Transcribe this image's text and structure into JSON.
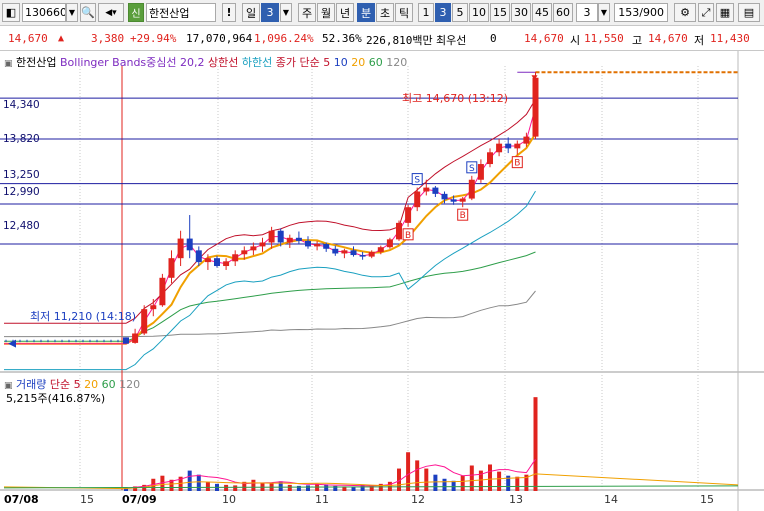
{
  "toolbar": {
    "code": "130660",
    "market_badge": "신",
    "name": "한전산업",
    "excl": "!",
    "periods": [
      "일",
      "3",
      "주",
      "월",
      "년",
      "분",
      "초",
      "틱"
    ],
    "intervals": [
      "1",
      "3",
      "5",
      "10",
      "15",
      "30",
      "45",
      "60"
    ],
    "count": "3",
    "paging": "153/900"
  },
  "quote": {
    "price": "14,670",
    "change": "3,380",
    "change_pct": "+29.94%",
    "volume": "17,070,964",
    "vol_ratio": "1,096.24%",
    "turnover_ratio": "52.36%",
    "amount": "226,810백만",
    "best_bid_label": "최우선",
    "best_bid_value": "0",
    "last": "14,670",
    "open_label": "시",
    "open": "11,550",
    "high_label": "고",
    "high": "14,670",
    "low_label": "저",
    "low": "11,430"
  },
  "price_legend": {
    "name": "한전산업",
    "bb_label": "Bollinger Bands중심선 20,2",
    "upper": "상한선",
    "lower": "하한선",
    "ma_label": "종가 단순 5",
    "ma10": "10",
    "ma20": "20",
    "ma60": "60",
    "ma120": "120"
  },
  "annotations": {
    "high": "최고 14,670 (13:12)",
    "low": "최저 11,210 (14:18)"
  },
  "volume_legend": {
    "label": "거래량",
    "ma_label": "단순 5",
    "ma20": "20",
    "ma60": "60",
    "ma120": "120",
    "current": "5,215주(416.87%)"
  },
  "price_levels": [
    "14,340",
    "13,820",
    "13,250",
    "12,990",
    "12,480"
  ],
  "x_axis": [
    "07/08",
    "15",
    "07/09",
    "10",
    "11",
    "12",
    "13",
    "14",
    "15"
  ],
  "colors": {
    "up": "#e0231e",
    "down": "#1c3fc0",
    "ma5": "#ff1493",
    "ma20": "#f0a000",
    "ma60": "#2e9e4a",
    "ma120": "#888888",
    "bb_upper": "#c0102a",
    "bb_lower": "#1aa0c0"
  },
  "chart_data": {
    "type": "candlestick",
    "price_ylim": [
      10900,
      14750
    ],
    "horizontal_levels": [
      14340,
      13820,
      13250,
      12990,
      12480
    ],
    "high": 14670,
    "low": 11210,
    "candles": [
      [
        11290,
        11290,
        11210,
        11210
      ],
      [
        11220,
        11400,
        11210,
        11340
      ],
      [
        11340,
        11700,
        11320,
        11650
      ],
      [
        11650,
        11780,
        11560,
        11700
      ],
      [
        11700,
        12100,
        11680,
        12050
      ],
      [
        12050,
        12400,
        11980,
        12300
      ],
      [
        12300,
        12650,
        12200,
        12550
      ],
      [
        12550,
        12850,
        12300,
        12400
      ],
      [
        12400,
        12450,
        12200,
        12250
      ],
      [
        12250,
        12350,
        12150,
        12300
      ],
      [
        12300,
        12330,
        12180,
        12200
      ],
      [
        12200,
        12300,
        12150,
        12260
      ],
      [
        12260,
        12400,
        12200,
        12350
      ],
      [
        12350,
        12450,
        12280,
        12400
      ],
      [
        12400,
        12500,
        12340,
        12450
      ],
      [
        12450,
        12560,
        12380,
        12500
      ],
      [
        12500,
        12700,
        12420,
        12650
      ],
      [
        12650,
        12680,
        12450,
        12500
      ],
      [
        12500,
        12600,
        12430,
        12560
      ],
      [
        12560,
        12640,
        12480,
        12520
      ],
      [
        12520,
        12580,
        12420,
        12450
      ],
      [
        12450,
        12520,
        12400,
        12480
      ],
      [
        12480,
        12500,
        12380,
        12420
      ],
      [
        12420,
        12460,
        12330,
        12360
      ],
      [
        12360,
        12420,
        12300,
        12400
      ],
      [
        12400,
        12450,
        12320,
        12340
      ],
      [
        12340,
        12380,
        12280,
        12320
      ],
      [
        12320,
        12400,
        12300,
        12380
      ],
      [
        12380,
        12460,
        12350,
        12440
      ],
      [
        12440,
        12560,
        12420,
        12540
      ],
      [
        12540,
        12780,
        12520,
        12750
      ],
      [
        12750,
        12980,
        12700,
        12950
      ],
      [
        12950,
        13200,
        12900,
        13150
      ],
      [
        13150,
        13300,
        13100,
        13200
      ],
      [
        13200,
        13220,
        13080,
        13120
      ],
      [
        13120,
        13150,
        13000,
        13050
      ],
      [
        13050,
        13100,
        12980,
        13020
      ],
      [
        13020,
        13080,
        12950,
        13060
      ],
      [
        13060,
        13350,
        13040,
        13300
      ],
      [
        13300,
        13560,
        13260,
        13500
      ],
      [
        13500,
        13700,
        13460,
        13650
      ],
      [
        13650,
        13820,
        13600,
        13760
      ],
      [
        13760,
        13840,
        13640,
        13700
      ],
      [
        13700,
        13800,
        13620,
        13760
      ],
      [
        13760,
        13900,
        13720,
        13850
      ],
      [
        13850,
        14670,
        13820,
        14600
      ]
    ],
    "volume_ylim": [
      0,
      1000
    ],
    "volume": [
      30,
      45,
      60,
      120,
      150,
      110,
      140,
      200,
      160,
      90,
      70,
      60,
      55,
      90,
      110,
      80,
      75,
      95,
      60,
      50,
      55,
      70,
      65,
      50,
      45,
      40,
      60,
      55,
      70,
      90,
      220,
      380,
      300,
      220,
      160,
      120,
      100,
      150,
      250,
      200,
      260,
      190,
      150,
      140,
      160,
      920
    ]
  }
}
